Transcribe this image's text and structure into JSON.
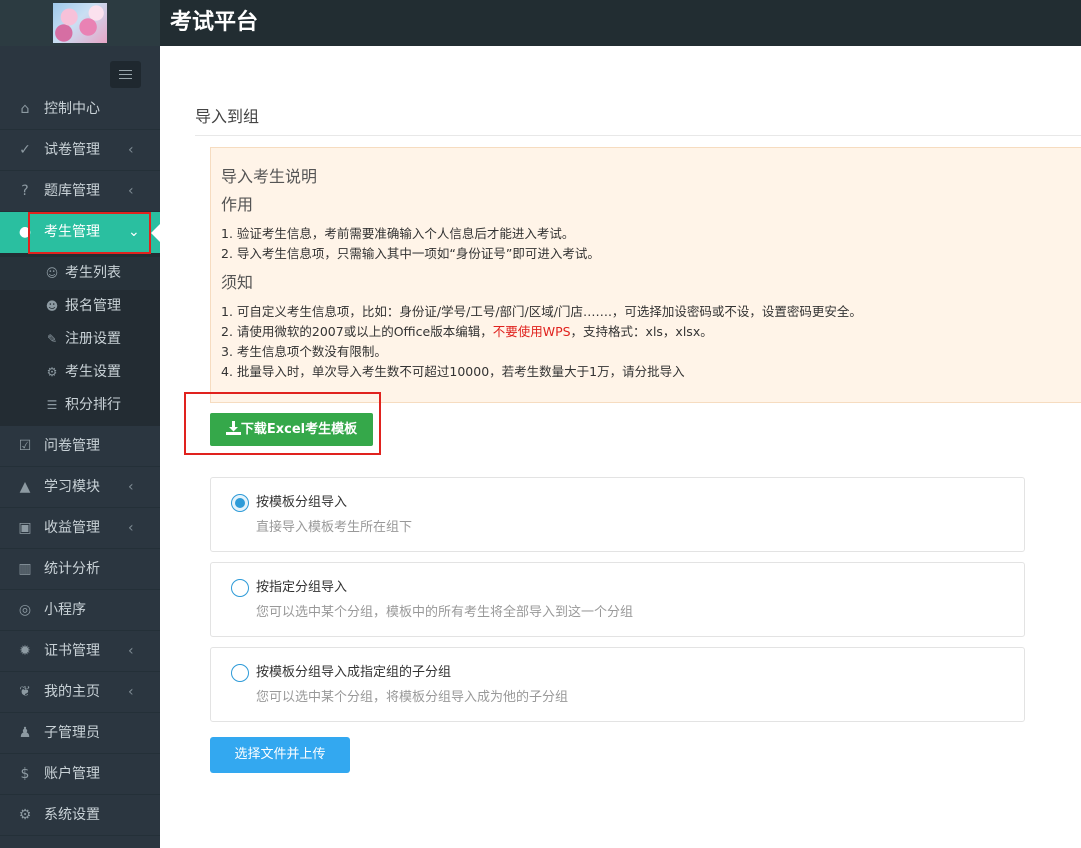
{
  "header": {
    "app_title": "考试平台",
    "logo_icon": "flower-logo-icon",
    "colors": {
      "topbar": "#222d32",
      "sidebar": "#2b3640",
      "active": "#2abfa0"
    }
  },
  "sidebar": {
    "toggle_icon": "hamburger-icon",
    "items": [
      {
        "label": "控制中心",
        "icon": "home-icon",
        "glyph": "⌂",
        "arrow": ""
      },
      {
        "label": "试卷管理",
        "icon": "check-circle-icon",
        "glyph": "✓",
        "arrow": "‹"
      },
      {
        "label": "题库管理",
        "icon": "question-circle-icon",
        "glyph": "?",
        "arrow": "‹"
      },
      {
        "label": "考生管理",
        "icon": "user-icon",
        "glyph": "●",
        "arrow": "⌄",
        "active": true
      },
      {
        "label": "问卷管理",
        "icon": "checkbox-icon",
        "glyph": "☑",
        "arrow": ""
      },
      {
        "label": "学习模块",
        "icon": "graduation-cap-icon",
        "glyph": "▲",
        "arrow": "‹"
      },
      {
        "label": "收益管理",
        "icon": "money-icon",
        "glyph": "▣",
        "arrow": "‹"
      },
      {
        "label": "统计分析",
        "icon": "bar-chart-icon",
        "glyph": "▥",
        "arrow": ""
      },
      {
        "label": "小程序",
        "icon": "wechat-icon",
        "glyph": "◎",
        "arrow": ""
      },
      {
        "label": "证书管理",
        "icon": "certificate-icon",
        "glyph": "✹",
        "arrow": "‹"
      },
      {
        "label": "我的主页",
        "icon": "leaf-icon",
        "glyph": "❦",
        "arrow": "‹"
      },
      {
        "label": "子管理员",
        "icon": "user-secret-icon",
        "glyph": "♟",
        "arrow": ""
      },
      {
        "label": "账户管理",
        "icon": "dollar-icon",
        "glyph": "$",
        "arrow": ""
      },
      {
        "label": "系统设置",
        "icon": "gear-icon",
        "glyph": "⚙",
        "arrow": ""
      }
    ],
    "submenu": [
      {
        "label": "考生列表",
        "icon": "users-icon",
        "glyph": "☺",
        "current": true
      },
      {
        "label": "报名管理",
        "icon": "user-plus-icon",
        "glyph": "☻"
      },
      {
        "label": "注册设置",
        "icon": "wrench-icon",
        "glyph": "✎"
      },
      {
        "label": "考生设置",
        "icon": "cog-icon",
        "glyph": "⚙"
      },
      {
        "label": "积分排行",
        "icon": "list-icon",
        "glyph": "☰"
      }
    ]
  },
  "main": {
    "page_title": "导入到组",
    "notice": {
      "heading": "导入考生说明",
      "section1_title": "作用",
      "section1_lines": [
        "1. 验证考生信息，考前需要准确输入个人信息后才能进入考试。",
        "2. 导入考生信息项，只需输入其中一项如“身份证号”即可进入考试。"
      ],
      "section2_title": "须知",
      "section2_line1": "1. 可自定义考生信息项，比如：身份证/学号/工号/部门/区域/门店…….，可选择加设密码或不设，设置密码更安全。",
      "section2_line2_pre": "2. 请使用微软的2007或以上的Office版本编辑，",
      "section2_line2_warn": "不要使用WPS",
      "section2_line2_post": "，支持格式：xls，xlsx。",
      "section2_line3": "3. 考生信息项个数没有限制。",
      "section2_line4": "4. 批量导入时，单次导入考生数不可超过10000，若考生数量大于1万，请分批导入"
    },
    "download_button": {
      "label": "下载Excel考生模板",
      "icon": "download-icon"
    },
    "options": [
      {
        "label": "按模板分组导入",
        "desc": "直接导入模板考生所在组下",
        "checked": true
      },
      {
        "label": "按指定分组导入",
        "desc": "您可以选中某个分组，模板中的所有考生将全部导入到这一个分组",
        "checked": false
      },
      {
        "label": "按模板分组导入成指定组的子分组",
        "desc": "您可以选中某个分组，将模板分组导入成为他的子分组",
        "checked": false
      }
    ],
    "upload_button": {
      "label": "选择文件并上传"
    }
  }
}
